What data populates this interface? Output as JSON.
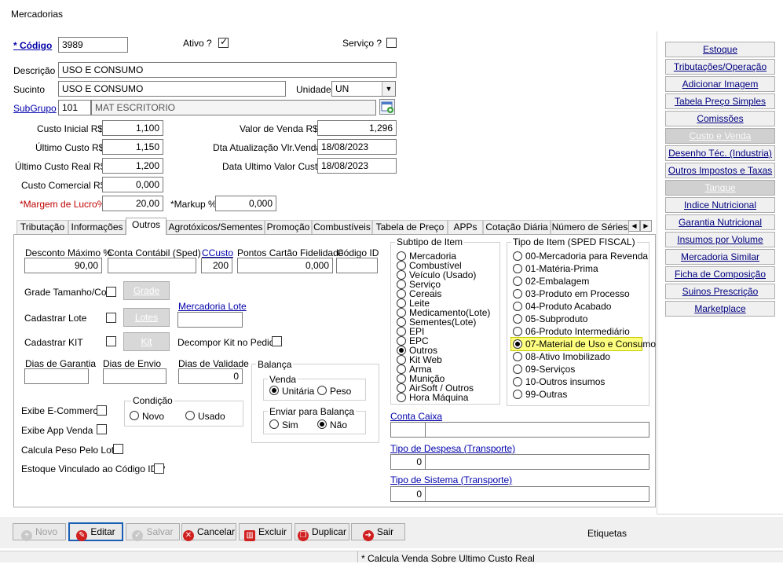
{
  "window": {
    "title": "Mercadorias"
  },
  "header": {
    "codigo_label": "* Código",
    "codigo_value": "3989",
    "ativo_label": "Ativo ?",
    "servico_label": "Serviço ?",
    "descricao_label": "Descrição",
    "descricao_value": "USO E CONSUMO",
    "sucinto_label": "Sucinto",
    "sucinto_value": "USO E CONSUMO",
    "unidade_label": "Unidade",
    "unidade_value": "UN",
    "subgrupo_label": "SubGrupo",
    "subgrupo_code": "101",
    "subgrupo_name": "MAT ESCRITORIO"
  },
  "costs": {
    "custo_inicial_label": "Custo Inicial R$",
    "custo_inicial": "1,100",
    "ultimo_custo_label": "Último Custo R$",
    "ultimo_custo": "1,150",
    "ultimo_custo_real_label": "Último Custo Real R$",
    "ultimo_custo_real": "1,200",
    "custo_comercial_label": "Custo Comercial R$",
    "custo_comercial": "0,000",
    "margem_label": "*Margem de Lucro%",
    "margem": "20,00",
    "markup_label": "*Markup %",
    "markup": "0,000",
    "valor_venda_label": "Valor de Venda R$",
    "valor_venda": "1,296",
    "dta_atualizacao_label": "Dta Atualização Vlr.Venda",
    "dta_atualizacao": "18/08/2023",
    "data_ultimo_label": "Data Ultimo Valor Custo",
    "data_ultimo": "18/08/2023"
  },
  "sidebar": {
    "items": [
      "Estoque",
      "Tributações/Operação",
      "Adicionar Imagem",
      "Tabela Preço Simples",
      "Comissões",
      "Custo e Venda",
      "Desenho Téc. (Industria)",
      "Outros Impostos e Taxas",
      "Tanque",
      "Indice Nutricional",
      "Garantia Nutricional",
      "Insumos por Volume",
      "Mercadoria Similar",
      "Ficha de Composição",
      "Suinos Prescrição",
      "Marketplace"
    ]
  },
  "tabs": [
    "Tributação",
    "Informações",
    "Outros",
    "Agrotóxicos/Sementes",
    "Promoção",
    "Combustíveis",
    "Tabela de Preço",
    "APPs",
    "Cotação Diária",
    "Número de Séries"
  ],
  "outros": {
    "desconto_label": "Desconto Máximo %",
    "desconto": "90,00",
    "conta_contabil_label": "Conta Contábil (Sped)",
    "ccusto_label": "CCusto",
    "ccusto": "200",
    "pontos_label": "Pontos Cartão Fidelidade",
    "pontos": "0,000",
    "codigo_id_label": "Código ID",
    "grade_label": "Grade Tamanho/Cor",
    "grade_btn": "Grade",
    "lote_label": "Cadastrar Lote",
    "lotes_btn": "Lotes",
    "mercadoria_lote_label": "Mercadoria Lote",
    "kit_label": "Cadastrar KIT",
    "kit_btn": "Kit",
    "decompor_label": "Decompor Kit no Pedido",
    "garantia_label": "Dias de Garantia",
    "envio_label": "Dias de Envio",
    "validade_label": "Dias de Validade",
    "validade": "0",
    "ecommerce_label": "Exibe E-Commerce",
    "app_label": "Exibe App Venda",
    "peso_lote_label": "Calcula Peso Pelo Lote",
    "estoque_vinc_label": "Estoque Vinculado ao Código ID ?",
    "condicao_title": "Condição",
    "novo": "Novo",
    "usado": "Usado",
    "balanca_title": "Balança",
    "venda_title": "Venda",
    "unitaria": "Unitária",
    "peso": "Peso",
    "enviar_title": "Enviar para Balança",
    "sim": "Sim",
    "nao": "Não"
  },
  "subtipo": {
    "title": "Subtipo de Item",
    "items": [
      "Mercadoria",
      "Combustível",
      "Veículo (Usado)",
      "Serviço",
      "Cereais",
      "Leite",
      "Medicamento(Lote)",
      "Sementes(Lote)",
      "EPI",
      "EPC",
      "Outros",
      "Kit Web",
      "Arma",
      "Munição",
      "AirSoft / Outros",
      "Hora Máquina"
    ],
    "selected": 10
  },
  "tipo_item": {
    "title": "Tipo de Item (SPED FISCAL)",
    "items": [
      "00-Mercadoria para Revenda",
      "01-Matéria-Prima",
      "02-Embalagem",
      "03-Produto em Processo",
      "04-Produto Acabado",
      "05-Subproduto",
      "06-Produto Intermediário",
      "07-Material de Uso e Consumo",
      "08-Ativo Imobilizado",
      "09-Serviços",
      "10-Outros insumos",
      "99-Outras"
    ],
    "selected": 7
  },
  "transport": {
    "conta_caixa_label": "Conta Caixa",
    "despesa_label": "Tipo de Despesa (Transporte)",
    "despesa": "0",
    "sistema_label": "Tipo de Sistema (Transporte)",
    "sistema": "0"
  },
  "footer": {
    "novo": "Novo",
    "editar": "Editar",
    "salvar": "Salvar",
    "cancelar": "Cancelar",
    "excluir": "Excluir",
    "duplicar": "Duplicar",
    "sair": "Sair",
    "etiquetas": "Etiquetas",
    "status": "* Calcula Venda Sobre Ultimo Custo  Real"
  }
}
